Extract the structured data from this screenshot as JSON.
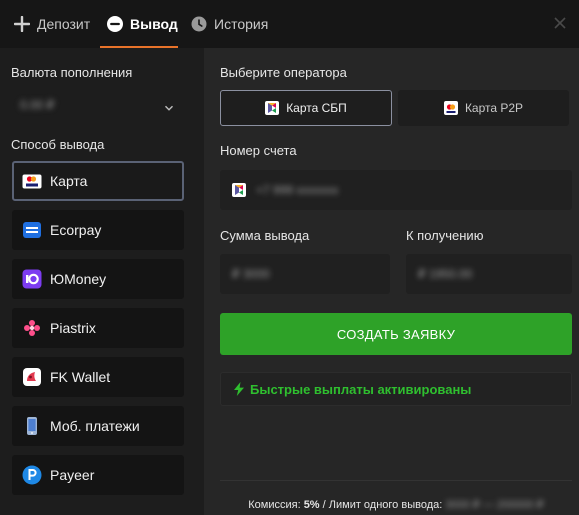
{
  "tabs": [
    {
      "label": "Депозит",
      "icon": "plus-icon"
    },
    {
      "label": "Вывод",
      "icon": "minus-circle-icon"
    },
    {
      "label": "История",
      "icon": "clock-icon"
    }
  ],
  "left": {
    "currency_label": "Валюта пополнения",
    "currency_value": "0.00 ₽",
    "method_label": "Способ вывода",
    "methods": [
      {
        "label": "Карта",
        "icon": "visa-card-icon"
      },
      {
        "label": "Ecorpay",
        "icon": "ecorpay-icon"
      },
      {
        "label": "ЮMoney",
        "icon": "yoomoney-icon"
      },
      {
        "label": "Piastrix",
        "icon": "piastrix-icon"
      },
      {
        "label": "FK Wallet",
        "icon": "fk-wallet-icon"
      },
      {
        "label": "Моб. платежи",
        "icon": "mobile-phone-icon"
      },
      {
        "label": "Payeer",
        "icon": "payeer-icon"
      }
    ]
  },
  "right": {
    "operator_label": "Выберите оператора",
    "operators": [
      {
        "label": "Карта СБП",
        "icon": "sbp-icon"
      },
      {
        "label": "Карта P2P",
        "icon": "card-icon"
      }
    ],
    "account_label": "Номер счета",
    "account_placeholder": "+7 999 xxxxxxx",
    "amount_label": "Сумма вывода",
    "amount_placeholder": "₽ 3000",
    "receive_label": "К получению",
    "receive_value": "₽ 1950.00",
    "submit_label": "СОЗДАТЬ ЗАЯВКУ",
    "fast_payouts": "Быстрые выплаты активированы",
    "commission_prefix": "Комиссия: ",
    "commission_value": "5%",
    "limit_prefix": " / Лимит одного вывода: ",
    "limit_value": "3000 ₽ — 200000 ₽"
  },
  "colors": {
    "accent": "#e8732a",
    "submit": "#2ea228",
    "fast_text": "#2fbf2f"
  }
}
